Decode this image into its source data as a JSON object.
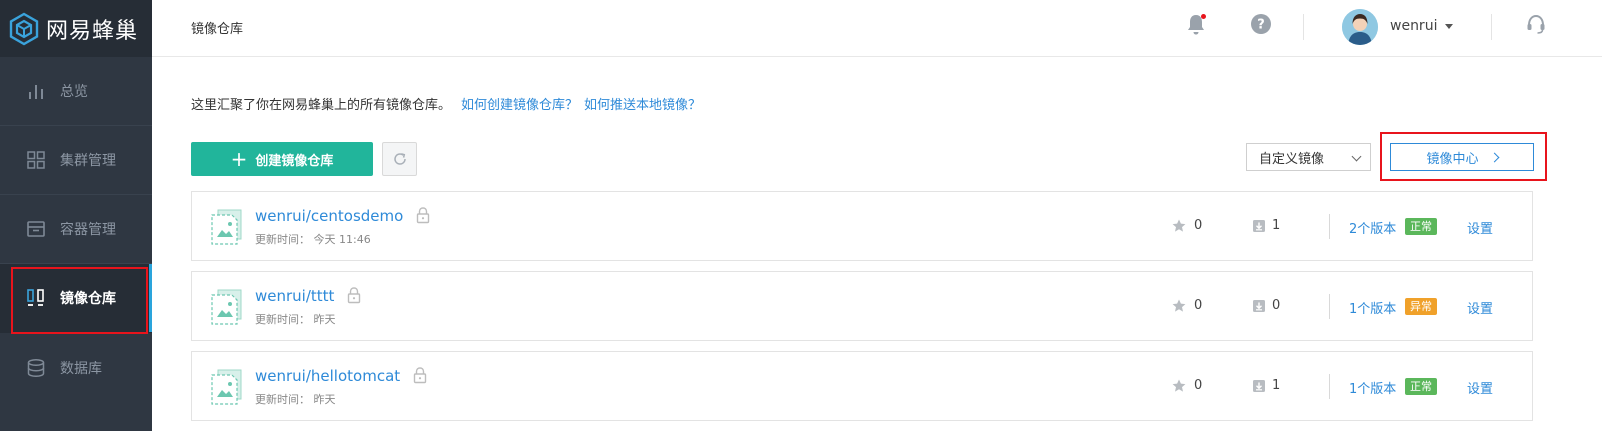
{
  "app": {
    "logo_text": "网易蜂巢"
  },
  "colors": {
    "sidebar_bg": "#2f3742",
    "accent_green": "#21b59b",
    "link_blue": "#2e8ad8",
    "status_ok": "#5bb75b",
    "status_error": "#f0a12a",
    "highlight_red": "#e8141c"
  },
  "sidebar": {
    "items": [
      {
        "label": "总览",
        "icon": "bar-chart-icon",
        "active": false
      },
      {
        "label": "集群管理",
        "icon": "grid-icon",
        "active": false
      },
      {
        "label": "容器管理",
        "icon": "box-icon",
        "active": false
      },
      {
        "label": "镜像仓库",
        "icon": "repository-icon",
        "active": true
      },
      {
        "label": "数据库",
        "icon": "database-icon",
        "active": false
      }
    ]
  },
  "header": {
    "breadcrumb": "镜像仓库",
    "username": "wenrui",
    "icons": [
      "bell-icon",
      "help-icon",
      "avatar",
      "headset-icon"
    ]
  },
  "main": {
    "intro_text": "这里汇聚了你在网易蜂巢上的所有镜像仓库。",
    "help_link_1": "如何创建镜像仓库？",
    "help_link_2": "如何推送本地镜像？",
    "create_button": "创建镜像仓库",
    "filter_select": "自定义镜像",
    "mirror_center_button": "镜像中心",
    "time_label": "更新时间：",
    "settings_label": "设置",
    "repos": [
      {
        "name": "wenrui/centosdemo",
        "time": "今天 11:46",
        "stars": "0",
        "downloads": "1",
        "versions": "2个版本",
        "status": "正常",
        "status_type": "ok"
      },
      {
        "name": "wenrui/tttt",
        "time": "昨天",
        "stars": "0",
        "downloads": "0",
        "versions": "1个版本",
        "status": "异常",
        "status_type": "err"
      },
      {
        "name": "wenrui/hellotomcat",
        "time": "昨天",
        "stars": "0",
        "downloads": "1",
        "versions": "1个版本",
        "status": "正常",
        "status_type": "ok"
      }
    ]
  }
}
